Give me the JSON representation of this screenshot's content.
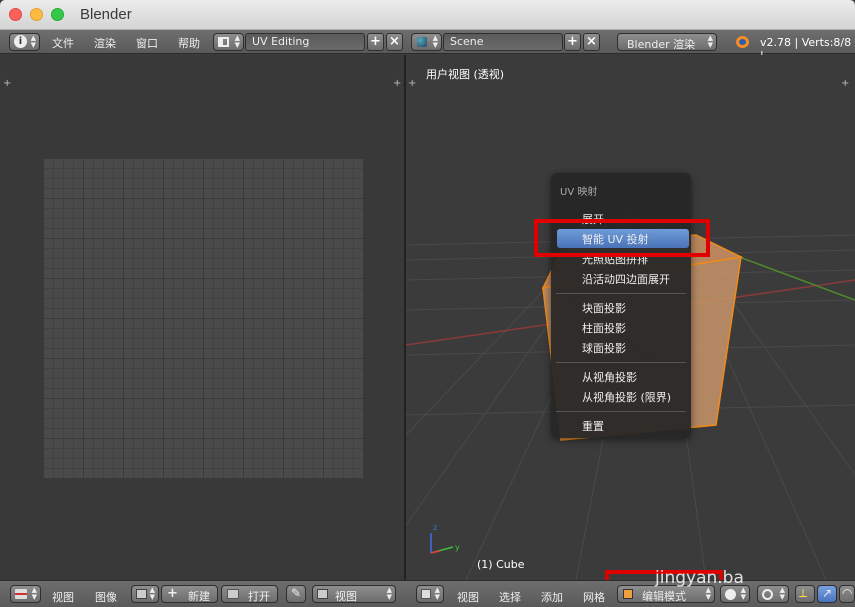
{
  "window": {
    "title": "Blender"
  },
  "topbar": {
    "menus": [
      "文件",
      "渲染",
      "窗口",
      "帮助"
    ],
    "layout": "UV Editing",
    "scene": "Scene",
    "render_engine": "Blender 渲染",
    "stats": "v2.78 | Verts:8/8 |"
  },
  "view3d": {
    "view_label": "用户视图 (透视)",
    "object_label": "(1) Cube"
  },
  "popup": {
    "title": "UV 映射",
    "items": [
      "展开",
      "智能 UV 投射",
      "光照贴图拼排",
      "沿活动四边面展开",
      "块面投影",
      "柱面投影",
      "球面投影",
      "从视角投影",
      "从视角投影 (限界)",
      "重置"
    ],
    "highlighted_index": 1
  },
  "bottombar": {
    "uv_menus": [
      "视图",
      "图像"
    ],
    "new_label": "新建",
    "open_label": "打开",
    "uv_view_select": "视图",
    "view3d_menus": [
      "视图",
      "选择",
      "添加",
      "网格"
    ],
    "mode": "编辑模式"
  },
  "watermark": "jingyan.ba",
  "colors": {
    "highlight": "#5680c2",
    "annotation_red": "#e00000",
    "cube": "#c8956a"
  }
}
